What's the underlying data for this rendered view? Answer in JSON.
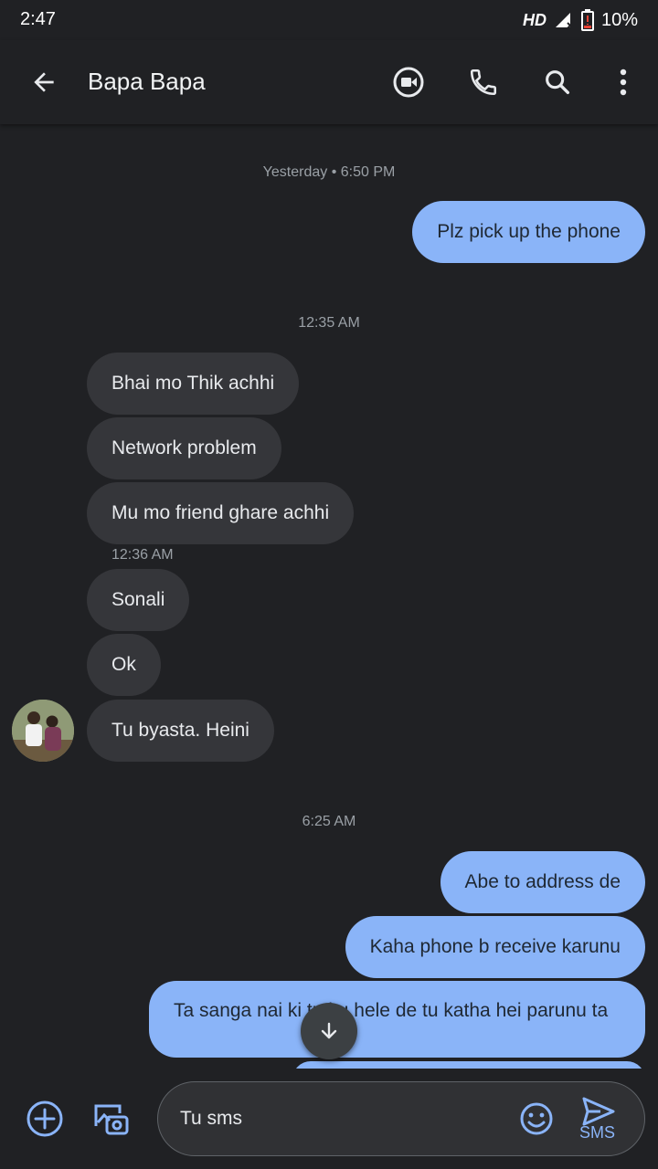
{
  "status": {
    "time": "2:47",
    "network": "HD",
    "battery": "10%"
  },
  "header": {
    "contact": "Bapa Bapa"
  },
  "messages": {
    "ts1": "Yesterday • 6:50 PM",
    "m1": "Plz pick up the phone",
    "ts2": "12:35 AM",
    "m2": "Bhai mo Thik achhi",
    "m3": "Network problem",
    "m4": "Mu mo friend  ghare achhi",
    "ts3": "12:36 AM",
    "m5": "Sonali",
    "m6": "Ok",
    "m7": "Tu byasta. Heini",
    "ts4": "6:25 AM",
    "m8": "Abe to address de",
    "m9": "Kaha phone b receive karunu",
    "m10": "Ta sanga nai ki tu ku hele de tu katha hei parunu ta"
  },
  "composer": {
    "text": "Tu sms",
    "send_label": "SMS"
  },
  "colors": {
    "outgoing": "#8ab4f8",
    "incoming": "#35363a",
    "background": "#202124"
  }
}
